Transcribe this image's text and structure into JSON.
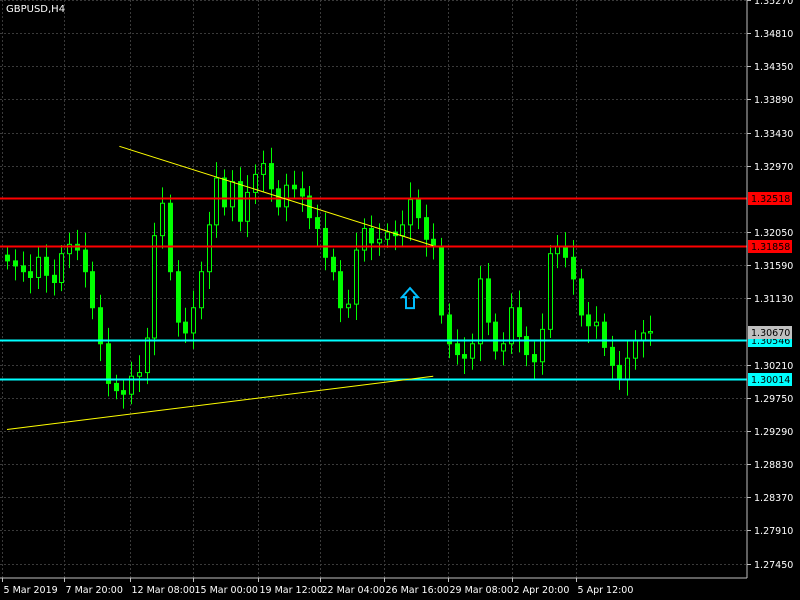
{
  "symbol_label": "GBPUSD,H4",
  "colors": {
    "background": "#000000",
    "grid": "#3a3a3a",
    "axis": "#c0c0c0",
    "candle": "#00ff00",
    "resistance": "#ff0000",
    "support": "#00ffff",
    "trendline": "#ffff00",
    "price_tag_text": "#000000",
    "current_price_tag": "#c0c0c0",
    "arrow": "#00bfff"
  },
  "icon": "up-arrow-icon",
  "chart_data": {
    "type": "candlestick",
    "title": "GBPUSD,H4",
    "ylim": [
      1.2725,
      1.3527
    ],
    "y_ticks": [
      "1.35270",
      "1.34810",
      "1.34350",
      "1.33890",
      "1.33430",
      "1.32970",
      "1.32518",
      "1.32050",
      "1.31858",
      "1.31590",
      "1.31130",
      "1.30670",
      "1.30546",
      "1.30210",
      "1.30014",
      "1.29750",
      "1.29290",
      "1.28830",
      "1.28370",
      "1.27910",
      "1.27450"
    ],
    "x_ticks": [
      "5 Mar 2019",
      "7 Mar 20:00",
      "12 Mar 08:00",
      "15 Mar 00:00",
      "19 Mar 12:00",
      "22 Mar 04:00",
      "26 Mar 16:00",
      "29 Mar 08:00",
      "2 Apr 20:00",
      "5 Apr 12:00"
    ],
    "horizontal_levels": [
      {
        "value": 1.32518,
        "label": "1.32518",
        "kind": "resistance"
      },
      {
        "value": 1.31858,
        "label": "1.31858",
        "kind": "resistance"
      },
      {
        "value": 1.30546,
        "label": "1.30546",
        "kind": "support"
      },
      {
        "value": 1.30014,
        "label": "1.30014",
        "kind": "support"
      }
    ],
    "current_price": {
      "value": 1.3067,
      "label": "1.30670"
    },
    "trendlines": [
      {
        "from": [
          14.5,
          1.3324
        ],
        "to": [
          55.0,
          1.3186
        ]
      },
      {
        "from": [
          0.0,
          1.2931
        ],
        "to": [
          55.0,
          1.3005
        ]
      }
    ],
    "arrow_marker": {
      "x": 52.0,
      "y": 1.3112,
      "direction": "up"
    },
    "closes": [
      1.3165,
      1.3158,
      1.315,
      1.3142,
      1.317,
      1.3145,
      1.3135,
      1.3175,
      1.3188,
      1.318,
      1.315,
      1.31,
      1.305,
      1.2995,
      1.2985,
      1.298,
      1.3005,
      1.301,
      1.3058,
      1.32,
      1.3245,
      1.315,
      1.308,
      1.3065,
      1.31,
      1.315,
      1.3215,
      1.328,
      1.324,
      1.3275,
      1.322,
      1.326,
      1.3285,
      1.33,
      1.3265,
      1.324,
      1.327,
      1.3265,
      1.3255,
      1.3225,
      1.321,
      1.317,
      1.315,
      1.31,
      1.3105,
      1.318,
      1.321,
      1.319,
      1.3195,
      1.3205,
      1.32,
      1.3215,
      1.325,
      1.3225,
      1.3195,
      1.3185,
      1.309,
      1.305,
      1.3035,
      1.303,
      1.305,
      1.314,
      1.308,
      1.304,
      1.305,
      1.31,
      1.306,
      1.3035,
      1.3025,
      1.307,
      1.3175,
      1.3185,
      1.317,
      1.314,
      1.309,
      1.3075,
      1.308,
      1.3045,
      1.302,
      1.3,
      1.303,
      1.3055,
      1.3065,
      1.3067
    ]
  }
}
